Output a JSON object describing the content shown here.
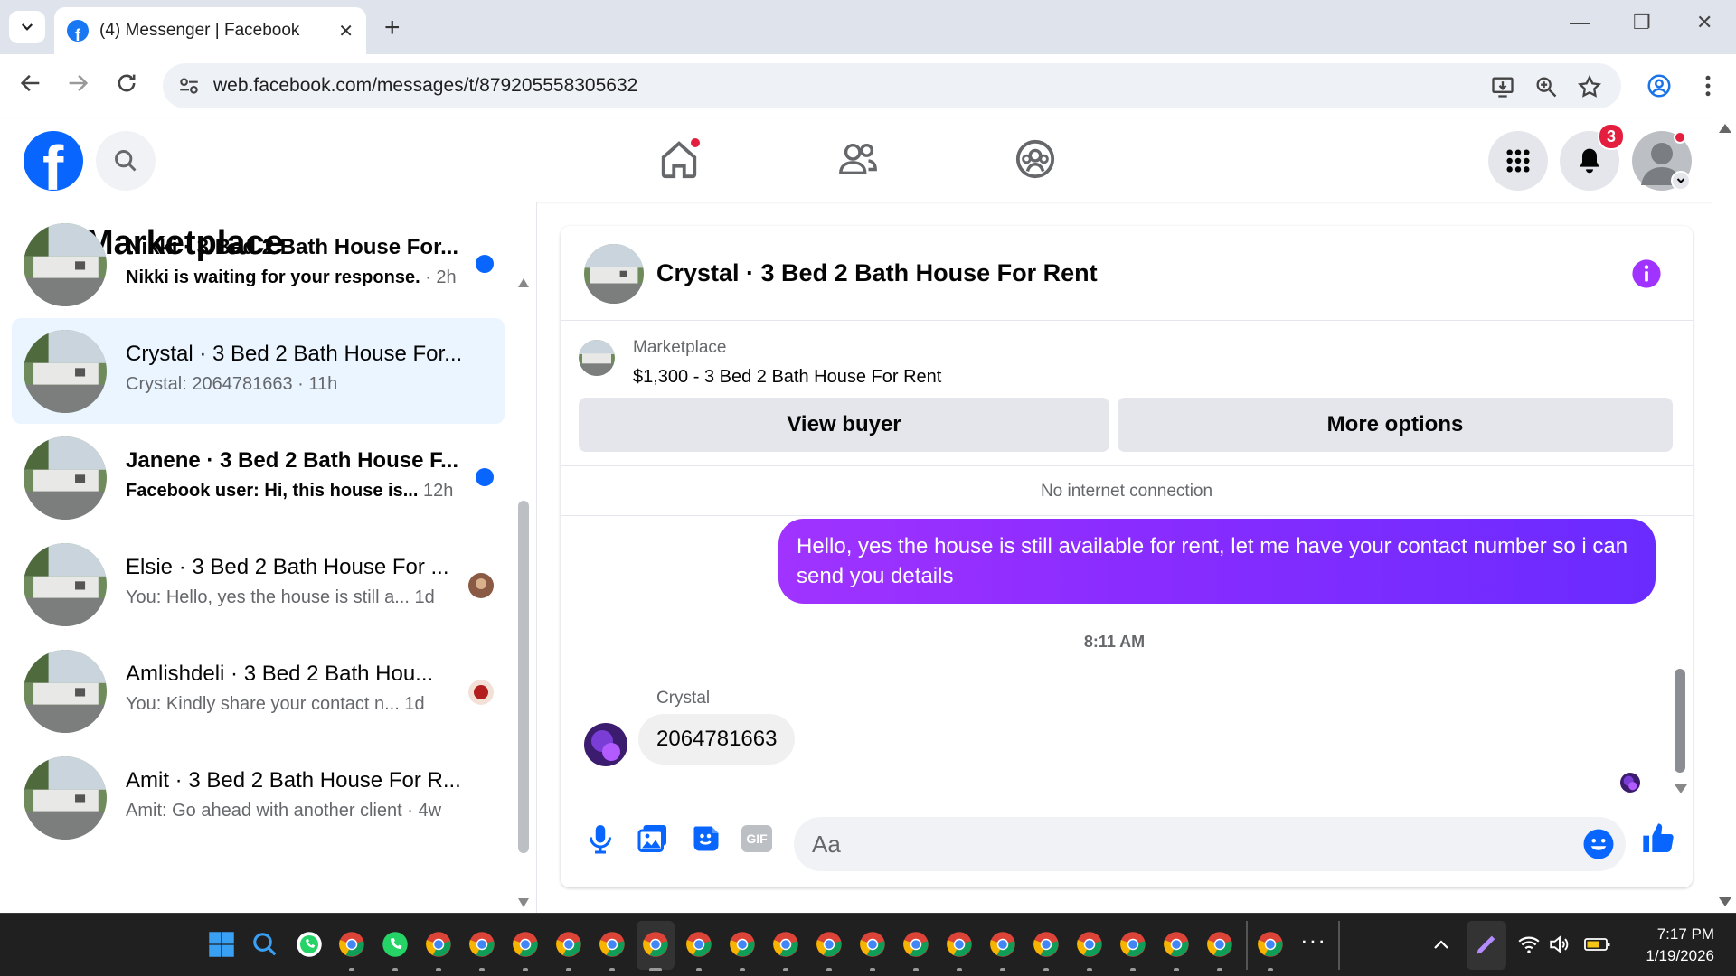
{
  "browser": {
    "tab_title": "(4) Messenger | Facebook",
    "tab_close": "✕",
    "new_tab": "+",
    "url": "web.facebook.com/messages/t/879205558305632",
    "min": "—",
    "restore": "❐",
    "close": "✕"
  },
  "header": {
    "notifications_count": "3"
  },
  "sidebar": {
    "title": "Marketplace",
    "conversations": [
      {
        "name": "Nikki · 3 Bed 2 Bath House For...",
        "snippet": "Nikki is waiting for your response.",
        "time": " · 2h"
      },
      {
        "name": "Crystal · 3 Bed 2 Bath House For...",
        "snippet": "Crystal: 2064781663",
        "time": " · 11h"
      },
      {
        "name": "Janene · 3 Bed 2 Bath House F...",
        "snippet": "Facebook user: Hi, this house is...",
        "time": " 12h"
      },
      {
        "name": "Elsie · 3 Bed 2 Bath House For ...",
        "snippet": "You: Hello, yes the house is still a...",
        "time": " 1d"
      },
      {
        "name": "Amlishdeli · 3 Bed 2 Bath Hou...",
        "snippet": "You: Kindly share your contact n...",
        "time": "   1d"
      },
      {
        "name": "Amit · 3 Bed 2 Bath House For R...",
        "snippet": "Amit: Go ahead with another client",
        "time": " · 4w"
      }
    ]
  },
  "chat": {
    "title": "Crystal · 3 Bed 2 Bath House For Rent",
    "marketplace_label": "Marketplace",
    "listing": "$1,300 - 3 Bed 2 Bath House For Rent",
    "view_buyer": "View buyer",
    "more_options": "More options",
    "status": "No internet connection",
    "outgoing_message": "Hello, yes the house is still available for rent, let me have your contact number so i can send you  details",
    "time_separator": "8:11 AM",
    "sender": "Crystal",
    "incoming_message": "2064781663",
    "composer_placeholder": "Aa",
    "gif_label": "GIF"
  },
  "taskbar": {
    "time": "7:17 PM",
    "date": "1/19/2026",
    "overflow": "···"
  }
}
